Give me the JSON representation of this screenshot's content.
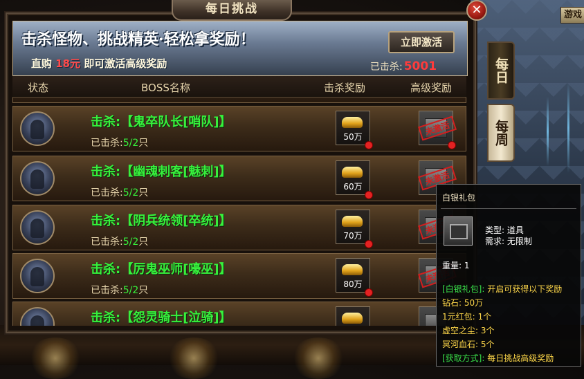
{
  "window": {
    "title": "每日挑战",
    "close_icon": "✕"
  },
  "corner_label": "游戏",
  "banner": {
    "headline": "击杀怪物、挑战精英·轻松拿奖励！",
    "activate_label": "立即激活",
    "sub_prefix": "直购",
    "sub_amount": "18元",
    "sub_suffix": "即可激活高级奖励",
    "killed_label": "已击杀:",
    "killed_value": "5001"
  },
  "columns": [
    "状态",
    "BOSS名称",
    "击杀奖励",
    "高级奖励"
  ],
  "rows": [
    {
      "name": "击杀:【鬼卒队长[哨队]】",
      "kills_label": "已击杀:",
      "kills_value": "5/2",
      "kills_unit": "只",
      "reward": "50万",
      "adv_stamp": "未激活"
    },
    {
      "name": "击杀:【幽魂刺客[魅刺]】",
      "kills_label": "已击杀:",
      "kills_value": "5/2",
      "kills_unit": "只",
      "reward": "60万",
      "adv_stamp": "未激活"
    },
    {
      "name": "击杀:【阴兵统领[卒统]】",
      "kills_label": "已击杀:",
      "kills_value": "5/2",
      "kills_unit": "只",
      "reward": "70万",
      "adv_stamp": "未激活"
    },
    {
      "name": "击杀:【厉鬼巫师[嚎巫]】",
      "kills_label": "已击杀:",
      "kills_value": "5/2",
      "kills_unit": "只",
      "reward": "80万",
      "adv_stamp": "未激活"
    },
    {
      "name": "击杀:【怨灵骑士[泣骑]】",
      "kills_label": "",
      "kills_value": "",
      "kills_unit": "",
      "reward": "",
      "adv_stamp": ""
    }
  ],
  "side_tabs": [
    "每日",
    "每周"
  ],
  "tooltip": {
    "title": "白银礼包",
    "type_line": "类型: 道具",
    "req_line": "需求: 无限制",
    "weight": "重量: 1",
    "desc_key": "[白银礼包]:",
    "desc_val": "开启可获得以下奖励",
    "items": [
      "钻石: 50万",
      "1元红包: 1个",
      "虚空之尘: 3个",
      "冥河血石: 5个"
    ],
    "source_key": "[获取方式]:",
    "source_val": "每日挑战高级奖励"
  }
}
